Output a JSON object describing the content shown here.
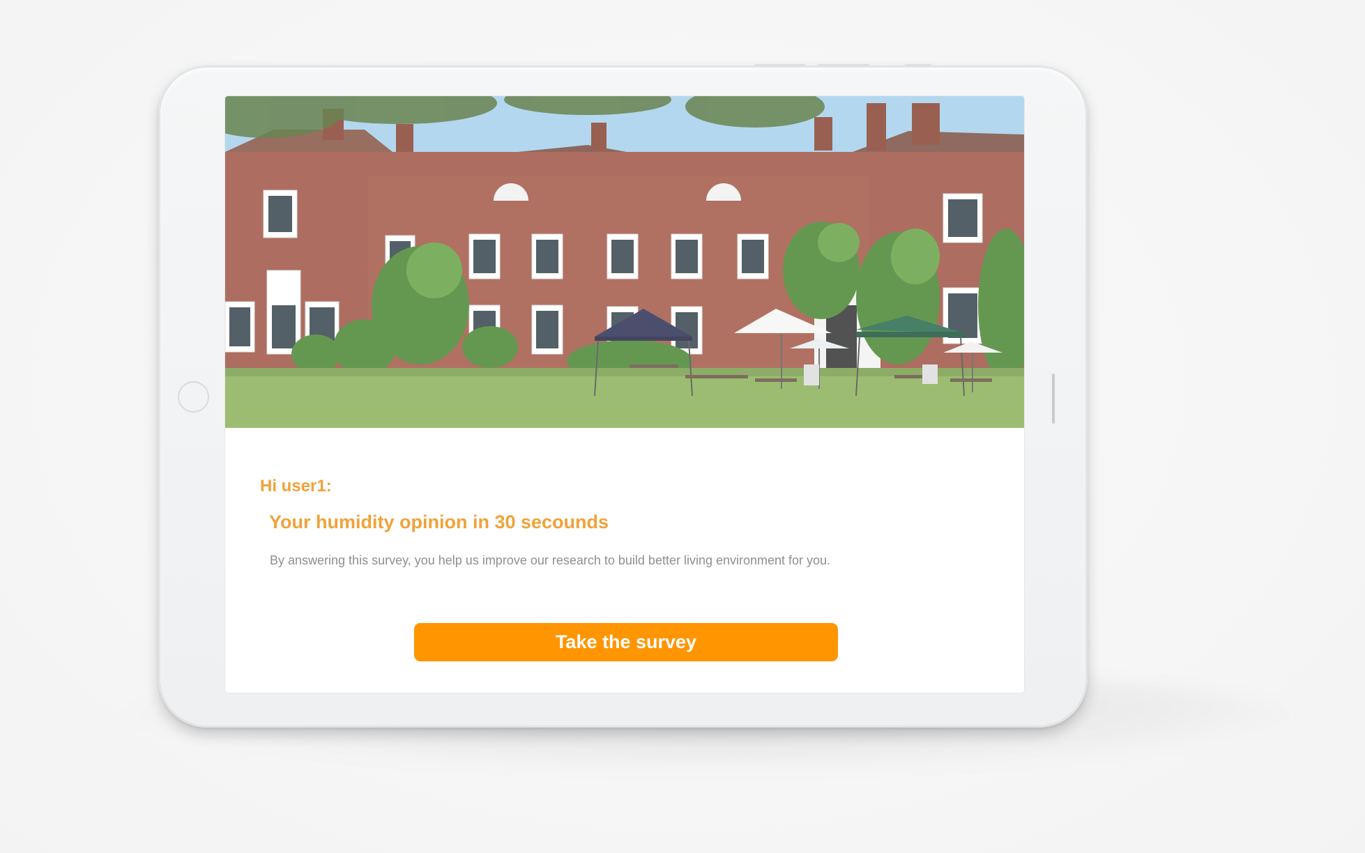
{
  "screen": {
    "greeting": "Hi user1:",
    "headline": "Your humidity opinion in 30 secounds",
    "description": "By answering this survey, you help us improve our research to build better living environment for you.",
    "cta_label": "Take the survey"
  },
  "colors": {
    "accent": "#f0a23a",
    "button": "#ff9500",
    "button_text": "#ffffff",
    "body_text": "#8f8f8f"
  }
}
